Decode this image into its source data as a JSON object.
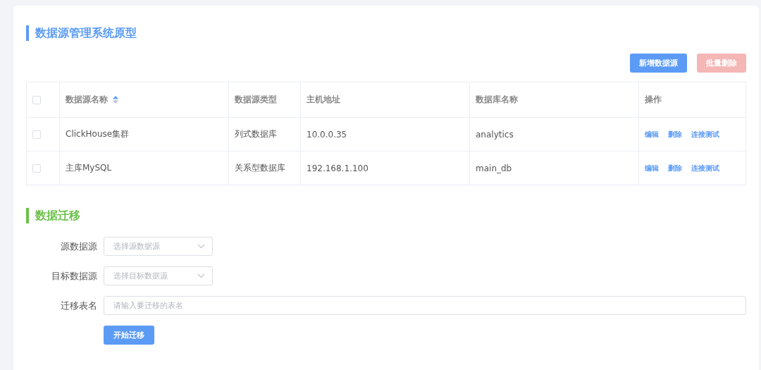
{
  "title": "数据源管理系统原型",
  "toolbar": [
    {
      "label": "新增数据源",
      "kind": "primary",
      "disabled": false
    },
    {
      "label": "批量删除",
      "kind": "danger",
      "disabled": true
    }
  ],
  "table": {
    "select_all": {
      "checked": false
    },
    "columns": [
      {
        "label": "数据源名称",
        "sortable": true
      },
      {
        "label": "数据源类型",
        "sortable": false
      },
      {
        "label": "主机地址",
        "sortable": false
      },
      {
        "label": "数据库名称",
        "sortable": false
      },
      {
        "label": "操作",
        "sortable": false
      }
    ],
    "rows": [
      {
        "checked": false,
        "cells": [
          "ClickHouse集群",
          "列式数据库",
          "10.0.0.35",
          "analytics"
        ],
        "actions": [
          "编辑",
          "删除",
          "连接测试"
        ]
      },
      {
        "checked": false,
        "cells": [
          "主库MySQL",
          "关系型数据库",
          "192.168.1.100",
          "main_db"
        ],
        "actions": [
          "编辑",
          "删除",
          "连接测试"
        ]
      }
    ]
  },
  "migration": {
    "title": "数据迁移",
    "fields": [
      {
        "label": "源数据源",
        "kind": "select",
        "placeholder": "选择源数据源"
      },
      {
        "label": "目标数据源",
        "kind": "select",
        "placeholder": "选择目标数据源"
      },
      {
        "label": "迁移表名",
        "kind": "input",
        "placeholder": "请输入要迁移的表名"
      }
    ],
    "submit": "开始迁移"
  }
}
